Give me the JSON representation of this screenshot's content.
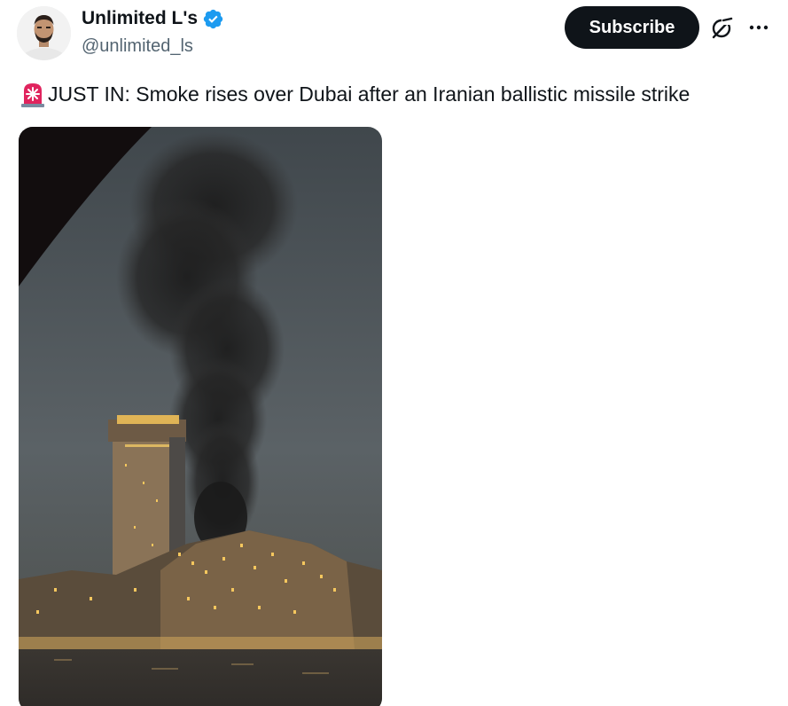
{
  "post": {
    "author": {
      "display_name": "Unlimited L's",
      "handle": "@unlimited_ls",
      "verified": true,
      "verified_icon": "verified-badge-icon",
      "avatar_icon": "avatar"
    },
    "header_actions": {
      "subscribe_label": "Subscribe",
      "grok_icon": "grok-icon",
      "more_icon": "more-options-icon"
    },
    "text": {
      "emoji": "siren-icon",
      "body": "JUST IN: Smoke rises over Dubai after an Iranian ballistic missile strike"
    },
    "media": {
      "type": "video-still",
      "description_icon": "media-image"
    }
  },
  "colors": {
    "text_primary": "#0f1419",
    "text_secondary": "#536471",
    "subscribe_bg": "#0f1419",
    "verified_blue": "#1d9bf0",
    "siren_red": "#e0245e"
  }
}
